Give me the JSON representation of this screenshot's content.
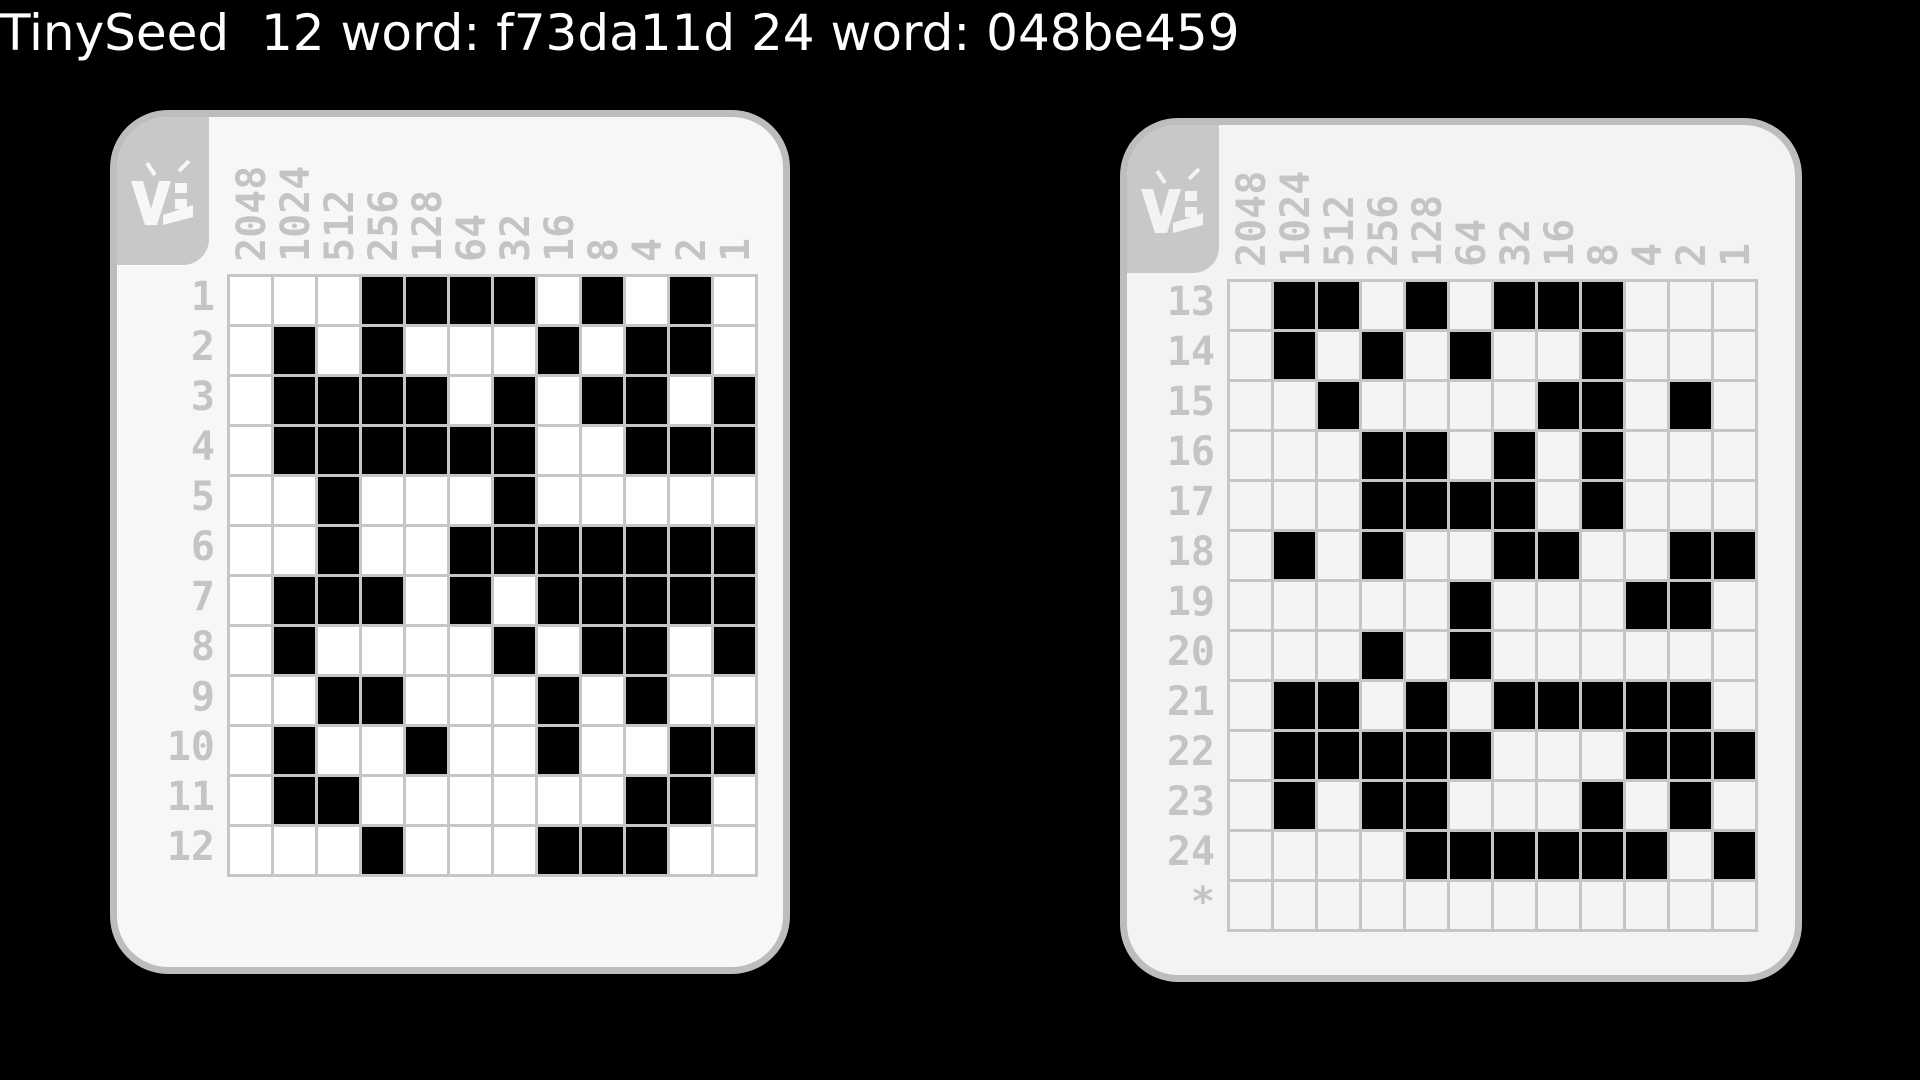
{
  "title": "TinySeed  12 word: f73da11d 24 word: 048be459",
  "bit_labels": [
    "2048",
    "1024",
    "512",
    "256",
    "128",
    "64",
    "32",
    "16",
    "8",
    "4",
    "2",
    "1"
  ],
  "colors": {
    "background": "#000000",
    "plate": "#f7f7f7",
    "border": "#bdbdbd",
    "label": "#c4c4c4",
    "filled": "#000000"
  },
  "icons": {
    "plate_logo": "tinyseed-logo-icon"
  },
  "plates": [
    {
      "rows": [
        {
          "label": "1",
          "bits": [
            0,
            0,
            0,
            1,
            1,
            1,
            1,
            0,
            1,
            0,
            1,
            0
          ]
        },
        {
          "label": "2",
          "bits": [
            0,
            1,
            0,
            1,
            0,
            0,
            0,
            1,
            0,
            1,
            1,
            0
          ]
        },
        {
          "label": "3",
          "bits": [
            0,
            1,
            1,
            1,
            1,
            0,
            1,
            0,
            1,
            1,
            0,
            1
          ]
        },
        {
          "label": "4",
          "bits": [
            0,
            1,
            1,
            1,
            1,
            1,
            1,
            0,
            0,
            1,
            1,
            1
          ]
        },
        {
          "label": "5",
          "bits": [
            0,
            0,
            1,
            0,
            0,
            0,
            1,
            0,
            0,
            0,
            0,
            0
          ]
        },
        {
          "label": "6",
          "bits": [
            0,
            0,
            1,
            0,
            0,
            1,
            1,
            1,
            1,
            1,
            1,
            1
          ]
        },
        {
          "label": "7",
          "bits": [
            0,
            1,
            1,
            1,
            0,
            1,
            0,
            1,
            1,
            1,
            1,
            1
          ]
        },
        {
          "label": "8",
          "bits": [
            0,
            1,
            0,
            0,
            0,
            0,
            1,
            0,
            1,
            1,
            0,
            1
          ]
        },
        {
          "label": "9",
          "bits": [
            0,
            0,
            1,
            1,
            0,
            0,
            0,
            1,
            0,
            1,
            0,
            0
          ]
        },
        {
          "label": "10",
          "bits": [
            0,
            1,
            0,
            0,
            1,
            0,
            0,
            1,
            0,
            0,
            1,
            1
          ]
        },
        {
          "label": "11",
          "bits": [
            0,
            1,
            1,
            0,
            0,
            0,
            0,
            0,
            0,
            1,
            1,
            0
          ]
        },
        {
          "label": "12",
          "bits": [
            0,
            0,
            0,
            1,
            0,
            0,
            0,
            1,
            1,
            1,
            0,
            0
          ]
        }
      ]
    },
    {
      "rows": [
        {
          "label": "13",
          "bits": [
            0,
            1,
            1,
            0,
            1,
            0,
            1,
            1,
            1,
            0,
            0,
            0
          ]
        },
        {
          "label": "14",
          "bits": [
            0,
            1,
            0,
            1,
            0,
            1,
            0,
            0,
            1,
            0,
            0,
            0
          ]
        },
        {
          "label": "15",
          "bits": [
            0,
            0,
            1,
            0,
            0,
            0,
            0,
            1,
            1,
            0,
            1,
            0
          ]
        },
        {
          "label": "16",
          "bits": [
            0,
            0,
            0,
            1,
            1,
            0,
            1,
            0,
            1,
            0,
            0,
            0
          ]
        },
        {
          "label": "17",
          "bits": [
            0,
            0,
            0,
            1,
            1,
            1,
            1,
            0,
            1,
            0,
            0,
            0
          ]
        },
        {
          "label": "18",
          "bits": [
            0,
            1,
            0,
            1,
            0,
            0,
            1,
            1,
            0,
            0,
            1,
            1
          ]
        },
        {
          "label": "19",
          "bits": [
            0,
            0,
            0,
            0,
            0,
            1,
            0,
            0,
            0,
            1,
            1,
            0
          ]
        },
        {
          "label": "20",
          "bits": [
            0,
            0,
            0,
            1,
            0,
            1,
            0,
            0,
            0,
            0,
            0,
            0
          ]
        },
        {
          "label": "21",
          "bits": [
            0,
            1,
            1,
            0,
            1,
            0,
            1,
            1,
            1,
            1,
            1,
            0
          ]
        },
        {
          "label": "22",
          "bits": [
            0,
            1,
            1,
            1,
            1,
            1,
            0,
            0,
            0,
            1,
            1,
            1
          ]
        },
        {
          "label": "23",
          "bits": [
            0,
            1,
            0,
            1,
            1,
            0,
            0,
            0,
            1,
            0,
            1,
            0
          ]
        },
        {
          "label": "24",
          "bits": [
            0,
            0,
            0,
            0,
            1,
            1,
            1,
            1,
            1,
            1,
            0,
            1
          ]
        },
        {
          "label": "*",
          "bits": [
            0,
            0,
            0,
            0,
            0,
            0,
            0,
            0,
            0,
            0,
            0,
            0
          ]
        }
      ]
    }
  ]
}
